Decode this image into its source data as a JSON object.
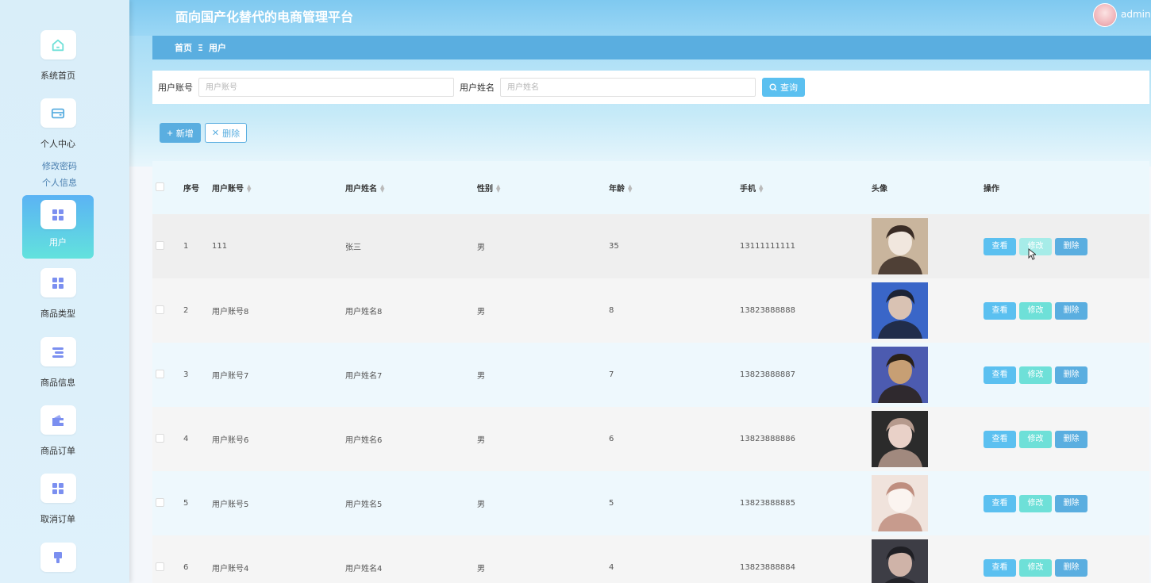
{
  "app": {
    "title": "面向国产化替代的电商管理平台",
    "user": "admin"
  },
  "sidebar": {
    "items": [
      {
        "label": "系统首页",
        "icon": "home-icon"
      },
      {
        "label": "个人中心",
        "icon": "wallet-icon"
      },
      {
        "label": "用户",
        "icon": "grid-icon"
      },
      {
        "label": "商品类型",
        "icon": "grid-icon"
      },
      {
        "label": "商品信息",
        "icon": "list-icon"
      },
      {
        "label": "商品订单",
        "icon": "wallet-icon"
      },
      {
        "label": "取消订单",
        "icon": "grid-icon"
      },
      {
        "label": "",
        "icon": "brush-icon"
      }
    ],
    "sub_items": [
      "修改密码",
      "个人信息"
    ],
    "active": "用户"
  },
  "breadcrumb": {
    "home": "首页",
    "separator": "Ξ",
    "current": "用户"
  },
  "search": {
    "account_label": "用户账号",
    "account_placeholder": "用户账号",
    "name_label": "用户姓名",
    "name_placeholder": "用户姓名",
    "button": "查询"
  },
  "actions": {
    "add": "新增",
    "delete": "删除"
  },
  "table": {
    "headers": [
      "序号",
      "用户账号",
      "用户姓名",
      "性别",
      "年龄",
      "手机",
      "头像",
      "操作"
    ],
    "rows": [
      {
        "index": "1",
        "account": "111",
        "name": "张三",
        "gender": "男",
        "age": "35",
        "phone": "13111111111"
      },
      {
        "index": "2",
        "account": "用户账号8",
        "name": "用户姓名8",
        "gender": "男",
        "age": "8",
        "phone": "13823888888"
      },
      {
        "index": "3",
        "account": "用户账号7",
        "name": "用户姓名7",
        "gender": "男",
        "age": "7",
        "phone": "13823888887"
      },
      {
        "index": "4",
        "account": "用户账号6",
        "name": "用户姓名6",
        "gender": "男",
        "age": "6",
        "phone": "13823888886"
      },
      {
        "index": "5",
        "account": "用户账号5",
        "name": "用户姓名5",
        "gender": "男",
        "age": "5",
        "phone": "13823888885"
      },
      {
        "index": "6",
        "account": "用户账号4",
        "name": "用户姓名4",
        "gender": "男",
        "age": "4",
        "phone": "13823888884"
      }
    ],
    "ops": {
      "view": "查看",
      "edit": "修改",
      "delete": "删除"
    }
  },
  "colors": {
    "primary": "#5aaee0",
    "accent": "#5bc0f0",
    "teal": "#6ee0d8"
  }
}
